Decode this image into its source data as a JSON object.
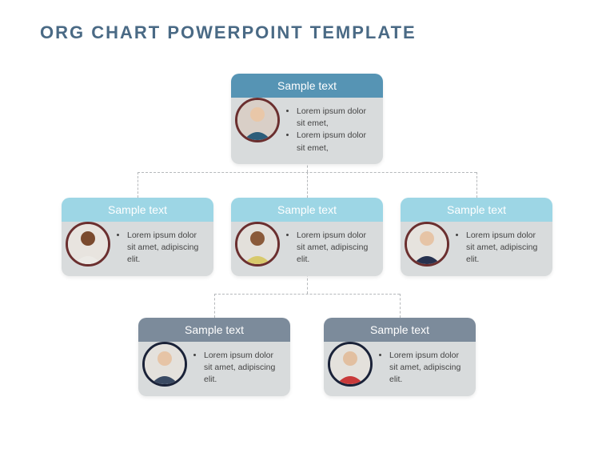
{
  "title": "ORG CHART POWERPOINT TEMPLATE",
  "top": {
    "header": "Sample text",
    "bullets": [
      "Lorem ipsum dolor sit emet,",
      "Lorem ipsum dolor sit emet,"
    ]
  },
  "row2": [
    {
      "header": "Sample text",
      "text": "Lorem ipsum dolor sit amet, adipiscing elit."
    },
    {
      "header": "Sample text",
      "text": "Lorem ipsum dolor sit amet, adipiscing elit."
    },
    {
      "header": "Sample text",
      "text": "Lorem ipsum dolor sit amet, adipiscing elit."
    }
  ],
  "row3": [
    {
      "header": "Sample text",
      "text": "Lorem ipsum dolor sit amet, adipiscing elit."
    },
    {
      "header": "Sample text",
      "text": "Lorem ipsum dolor sit amet, adipiscing elit."
    }
  ],
  "avatars": {
    "top": {
      "bg": "#d9cfc7",
      "shirt": "#2c5d7a",
      "skin": "#e9c7a8"
    },
    "r2a": {
      "bg": "#e8e4df",
      "shirt": "#eceae6",
      "skin": "#7a4a2e"
    },
    "r2b": {
      "bg": "#e3e0db",
      "shirt": "#d8c96b",
      "skin": "#8a5a3a"
    },
    "r2c": {
      "bg": "#e6e3de",
      "shirt": "#28324f",
      "skin": "#e6c4a6"
    },
    "r3a": {
      "bg": "#e4e1dc",
      "shirt": "#3a4a63",
      "skin": "#e6c4a6"
    },
    "r3b": {
      "bg": "#e4e1dc",
      "shirt": "#c93a3a",
      "skin": "#e2bfa0"
    }
  }
}
